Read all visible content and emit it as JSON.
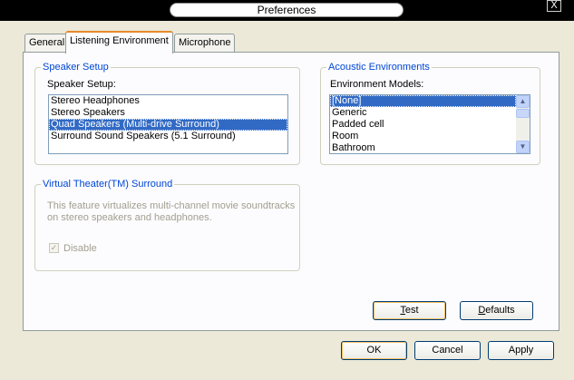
{
  "window": {
    "title": "Preferences",
    "close_glyph": "X"
  },
  "tabs": [
    {
      "label": "General"
    },
    {
      "label": "Listening Environment"
    },
    {
      "label": "Microphone"
    }
  ],
  "speaker_setup": {
    "group_title": "Speaker Setup",
    "label": "Speaker Setup:",
    "items": [
      "Stereo Headphones",
      "Stereo Speakers",
      "Quad Speakers (Multi-drive Surround)",
      "Surround Sound Speakers (5.1 Surround)"
    ],
    "selected": "Quad Speakers (Multi-drive Surround)"
  },
  "acoustic": {
    "group_title": "Acoustic Environments",
    "label": "Environment Models:",
    "items": [
      "[None]",
      "Generic",
      "Padded cell",
      "Room",
      "Bathroom"
    ],
    "selected": "[None]"
  },
  "virtual_theater": {
    "group_title": "Virtual Theater(TM) Surround",
    "description_line1": "This feature virtualizes multi-channel movie soundtracks",
    "description_line2": "on stereo speakers and headphones.",
    "checkbox_label": "Disable",
    "checked": true
  },
  "buttons": {
    "test_first": "T",
    "test_rest": "est",
    "defaults_first": "D",
    "defaults_rest": "efaults",
    "ok": "OK",
    "cancel": "Cancel",
    "apply": "Apply"
  }
}
